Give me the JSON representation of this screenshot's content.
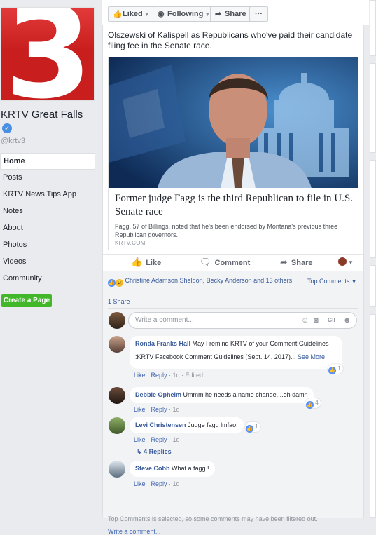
{
  "page": {
    "logo_text": "3",
    "name": "KRTV Great Falls",
    "handle": "@krtv3",
    "nav": [
      {
        "label": "Home"
      },
      {
        "label": "Posts"
      },
      {
        "label": "KRTV News Tips App"
      },
      {
        "label": "Notes"
      },
      {
        "label": "About"
      },
      {
        "label": "Photos"
      },
      {
        "label": "Videos"
      },
      {
        "label": "Community"
      }
    ],
    "create_page": "Create a Page"
  },
  "topbar": {
    "liked": "Liked",
    "following": "Following",
    "share": "Share",
    "more": "···"
  },
  "post": {
    "text": "Olszewski of Kalispell as Republicans who've paid their candidate filing fee in the Senate race.",
    "link_title": "Former judge Fagg is the third Republican to file in U.S. Senate race",
    "link_desc": "Fagg, 57 of Billings, noted that he's been endorsed by Montana's previous three Republican governors.",
    "link_domain": "KRTV.COM",
    "actions": {
      "like": "Like",
      "comment": "Comment",
      "share": "Share"
    }
  },
  "comments_area": {
    "reactions_text": "Christine Adamson Sheldon, Becky Anderson and 13 others",
    "top_comments": "Top Comments",
    "shares": "1 Share",
    "write_placeholder": "Write a comment...",
    "comments": [
      {
        "name": "Ronda Franks Hall",
        "text": "May I remind KRTV of your Comment Guidelines",
        "text2": ":KRTV Facebook Comment Guidelines (Sept. 14, 2017)...",
        "see_more": "See More",
        "like": "Like",
        "reply": "Reply",
        "time": "1d",
        "extra": "Edited",
        "likes": "1"
      },
      {
        "name": "Debbie Opheim",
        "text": "Ummm he needs a name change....oh damn",
        "like": "Like",
        "reply": "Reply",
        "time": "1d",
        "likes": "4"
      },
      {
        "name": "Levi Christensen",
        "text": "Judge fagg lmfao!",
        "like": "Like",
        "reply": "Reply",
        "time": "1d",
        "likes": "1",
        "replies": "4 Replies"
      },
      {
        "name": "Steve Cobb",
        "text": "What a fagg !",
        "like": "Like",
        "reply": "Reply",
        "time": "1d"
      }
    ],
    "filtered_note": "Top Comments is selected, so some comments may have been filtered out.",
    "write_more": "Write a comment..."
  },
  "icons": [
    "thumbs-up-icon",
    "rss-icon",
    "share-arrow-icon",
    "comment-icon",
    "camera-icon",
    "gif-icon",
    "sticker-icon",
    "emoji-icon",
    "verified-icon"
  ],
  "colors": {
    "fb_blue": "#4267b2",
    "link_blue": "#365899",
    "krtv_red": "#c81e1e",
    "create_green": "#42b72a"
  }
}
